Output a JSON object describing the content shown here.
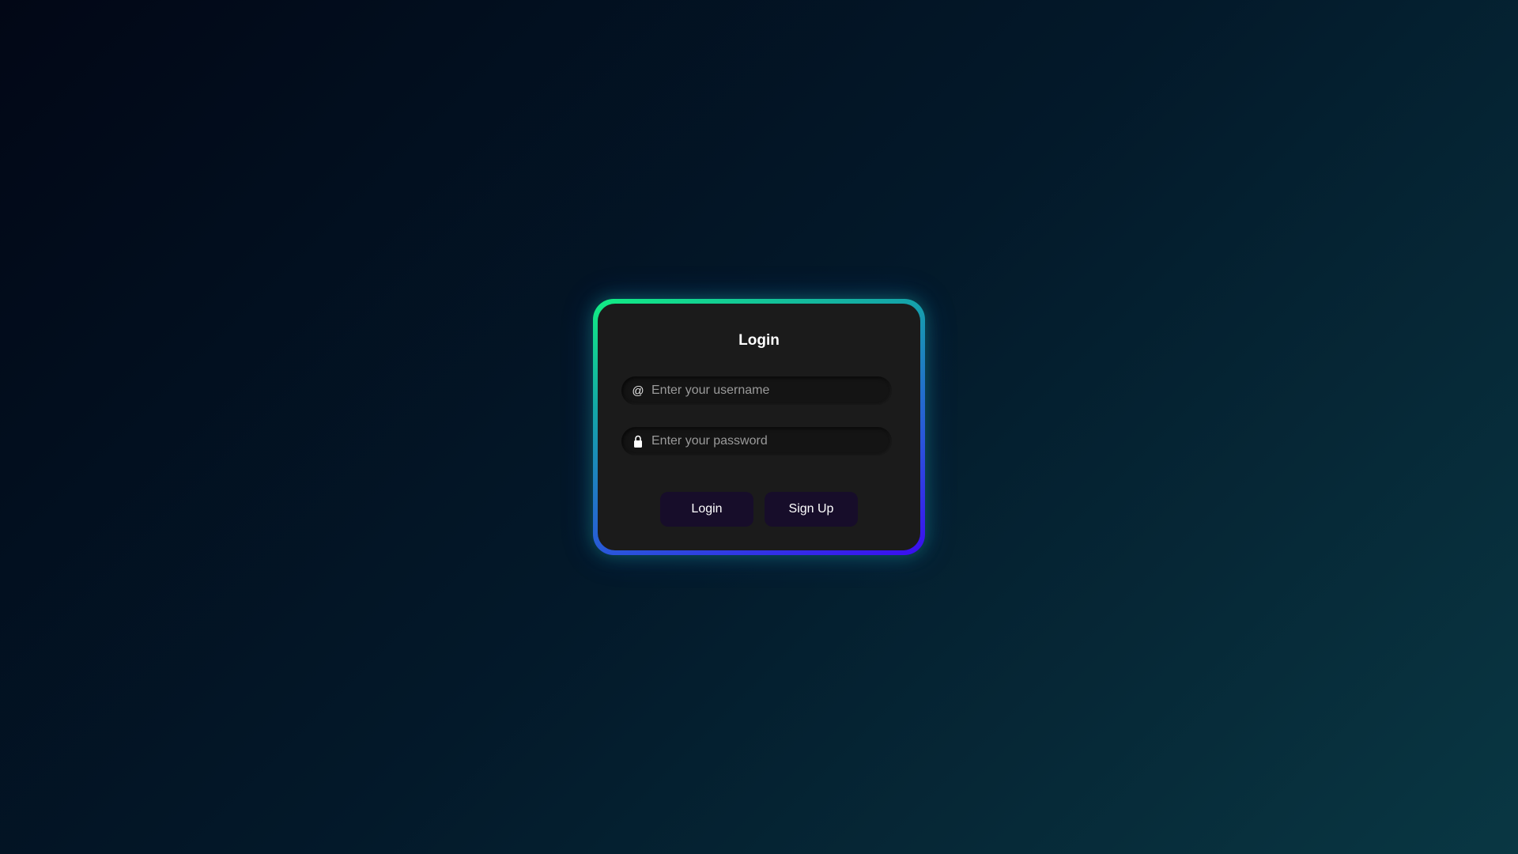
{
  "login_card": {
    "title": "Login",
    "username": {
      "icon": "at-icon",
      "icon_glyph": "@",
      "placeholder": "Enter your username",
      "value": ""
    },
    "password": {
      "icon": "lock-icon",
      "placeholder": "Enter your password",
      "value": ""
    },
    "buttons": {
      "login_label": "Login",
      "signup_label": "Sign Up"
    },
    "colors": {
      "gradient_start": "#12ee83",
      "gradient_end": "#3b0cf0",
      "card_background": "#1b1b1b",
      "button_background": "#170d2a"
    }
  }
}
